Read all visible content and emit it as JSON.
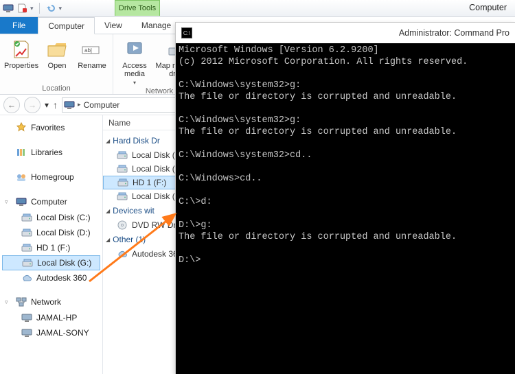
{
  "window_title": "Computer",
  "drive_tools_label": "Drive Tools",
  "tabs": {
    "file": "File",
    "computer": "Computer",
    "view": "View",
    "manage": "Manage"
  },
  "ribbon": {
    "properties": "Properties",
    "open": "Open",
    "rename": "Rename",
    "access_media": "Access\nmedia",
    "map_network": "Map network\ndrive",
    "group_location": "Location",
    "group_network": "Network"
  },
  "addressbar": {
    "location": "Computer"
  },
  "nav": {
    "favorites": "Favorites",
    "libraries": "Libraries",
    "homegroup": "Homegroup",
    "computer": "Computer",
    "drives": [
      "Local Disk (C:)",
      "Local Disk (D:)",
      "HD 1 (F:)",
      "Local Disk (G:)",
      "Autodesk 360"
    ],
    "network": "Network",
    "network_items": [
      "JAMAL-HP",
      "JAMAL-SONY"
    ]
  },
  "content": {
    "header_name": "Name",
    "group_hdd": "Hard Disk Dr",
    "hdd_items": [
      "Local Disk (",
      "Local Disk (",
      "HD 1 (F:)",
      "Local Disk ("
    ],
    "group_devices": "Devices wit",
    "device_items": [
      "DVD RW Dr"
    ],
    "group_other": "Other (1)",
    "other_items": [
      "Autodesk 36"
    ]
  },
  "cmd": {
    "title": "Administrator: Command Pro",
    "lines": [
      "Microsoft Windows [Version 6.2.9200]",
      "(c) 2012 Microsoft Corporation. All rights reserved.",
      "",
      "C:\\Windows\\system32>g:",
      "The file or directory is corrupted and unreadable.",
      "",
      "C:\\Windows\\system32>g:",
      "The file or directory is corrupted and unreadable.",
      "",
      "C:\\Windows\\system32>cd..",
      "",
      "C:\\Windows>cd..",
      "",
      "C:\\>d:",
      "",
      "D:\\>g:",
      "The file or directory is corrupted and unreadable.",
      "",
      "D:\\>"
    ]
  }
}
